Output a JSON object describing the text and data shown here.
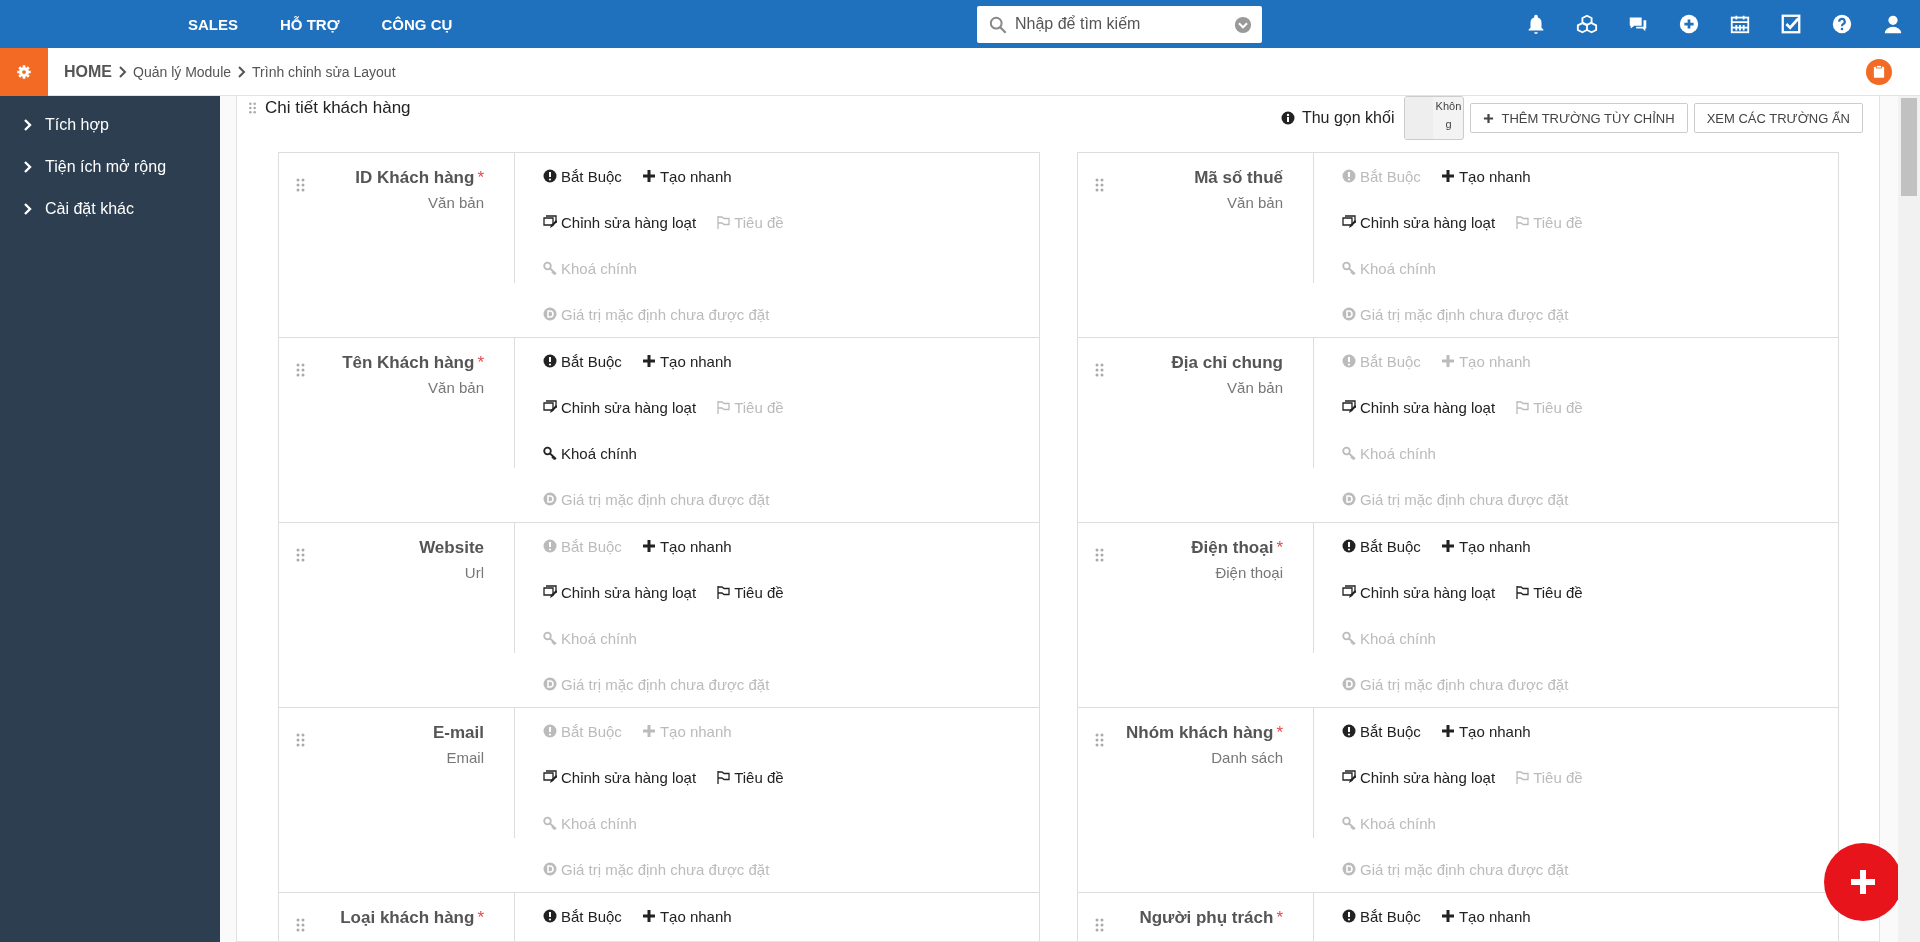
{
  "top_nav": {
    "items": [
      {
        "label": "SALES"
      },
      {
        "label": "HỖ TRỢ"
      },
      {
        "label": "CÔNG CỤ"
      }
    ],
    "search": {
      "placeholder": "Nhập để tìm kiếm"
    },
    "icons": [
      {
        "kind": "bell"
      },
      {
        "kind": "cubes"
      },
      {
        "kind": "comments"
      },
      {
        "kind": "plus"
      },
      {
        "kind": "calendar"
      },
      {
        "kind": "check"
      },
      {
        "kind": "help"
      },
      {
        "kind": "user"
      }
    ]
  },
  "breadcrumb": {
    "items": [
      {
        "label": "HOME",
        "kind": "home"
      },
      {
        "label": "Quản lý Module",
        "kind": "link"
      },
      {
        "label": "Trình chỉnh sửa Layout",
        "kind": "link"
      }
    ]
  },
  "sidebar": {
    "items": [
      {
        "label": "Tích hợp"
      },
      {
        "label": "Tiện ích mở rộng"
      },
      {
        "label": "Cài đặt khác"
      }
    ]
  },
  "block": {
    "title": "Chi tiết khách hàng",
    "collapse": {
      "label": "Thu gọn khối",
      "toggle_text": "Không",
      "on": false
    },
    "buttons": [
      {
        "label": "THÊM TRƯỜNG TÙY CHỈNH",
        "kind": "add"
      },
      {
        "label": "XEM CÁC TRƯỜNG ẨN",
        "kind": "plain"
      }
    ],
    "columns": [
      {
        "fields": [
          {
            "name": "ID Khách hàng",
            "required_mark": "*",
            "type": "Văn bản",
            "option_rows": [
              [
                {
                  "kind": "required",
                  "label": "Bắt Buộc",
                  "on": true
                },
                {
                  "kind": "quick_create",
                  "label": "Tạo nhanh",
                  "on": true
                }
              ],
              [
                {
                  "kind": "mass_edit",
                  "label": "Chỉnh sửa hàng loạt",
                  "on": true
                },
                {
                  "kind": "title",
                  "label": "Tiêu đề",
                  "on": false
                }
              ],
              [
                {
                  "kind": "primary_key",
                  "label": "Khoá chính",
                  "on": false
                }
              ],
              [
                {
                  "kind": "default",
                  "label": "Giá trị mặc định chưa được đặt",
                  "on": false
                }
              ]
            ]
          },
          {
            "name": "Tên Khách hàng",
            "required_mark": "*",
            "type": "Văn bản",
            "option_rows": [
              [
                {
                  "kind": "required",
                  "label": "Bắt Buộc",
                  "on": true
                },
                {
                  "kind": "quick_create",
                  "label": "Tạo nhanh",
                  "on": true
                }
              ],
              [
                {
                  "kind": "mass_edit",
                  "label": "Chỉnh sửa hàng loạt",
                  "on": true
                },
                {
                  "kind": "title",
                  "label": "Tiêu đề",
                  "on": false
                }
              ],
              [
                {
                  "kind": "primary_key",
                  "label": "Khoá chính",
                  "on": true
                }
              ],
              [
                {
                  "kind": "default",
                  "label": "Giá trị mặc định chưa được đặt",
                  "on": false
                }
              ]
            ]
          },
          {
            "name": "Website",
            "type": "Url",
            "option_rows": [
              [
                {
                  "kind": "required",
                  "label": "Bắt Buộc",
                  "on": false
                },
                {
                  "kind": "quick_create",
                  "label": "Tạo nhanh",
                  "on": true
                }
              ],
              [
                {
                  "kind": "mass_edit",
                  "label": "Chỉnh sửa hàng loạt",
                  "on": true
                },
                {
                  "kind": "title",
                  "label": "Tiêu đề",
                  "on": true
                }
              ],
              [
                {
                  "kind": "primary_key",
                  "label": "Khoá chính",
                  "on": false
                }
              ],
              [
                {
                  "kind": "default",
                  "label": "Giá trị mặc định chưa được đặt",
                  "on": false
                }
              ]
            ]
          },
          {
            "name": "E-mail",
            "type": "Email",
            "option_rows": [
              [
                {
                  "kind": "required",
                  "label": "Bắt Buộc",
                  "on": false
                },
                {
                  "kind": "quick_create",
                  "label": "Tạo nhanh",
                  "on": false
                }
              ],
              [
                {
                  "kind": "mass_edit",
                  "label": "Chỉnh sửa hàng loạt",
                  "on": true
                },
                {
                  "kind": "title",
                  "label": "Tiêu đề",
                  "on": true
                }
              ],
              [
                {
                  "kind": "primary_key",
                  "label": "Khoá chính",
                  "on": false
                }
              ],
              [
                {
                  "kind": "default",
                  "label": "Giá trị mặc định chưa được đặt",
                  "on": false
                }
              ]
            ]
          },
          {
            "name": "Loại khách hàng",
            "required_mark": "*",
            "option_rows": [
              [
                {
                  "kind": "required",
                  "label": "Bắt Buộc",
                  "on": true
                },
                {
                  "kind": "quick_create",
                  "label": "Tạo nhanh",
                  "on": true
                }
              ]
            ]
          }
        ]
      },
      {
        "fields": [
          {
            "name": "Mã số thuế",
            "type": "Văn bản",
            "option_rows": [
              [
                {
                  "kind": "required",
                  "label": "Bắt Buộc",
                  "on": false
                },
                {
                  "kind": "quick_create",
                  "label": "Tạo nhanh",
                  "on": true
                }
              ],
              [
                {
                  "kind": "mass_edit",
                  "label": "Chỉnh sửa hàng loạt",
                  "on": true
                },
                {
                  "kind": "title",
                  "label": "Tiêu đề",
                  "on": false
                }
              ],
              [
                {
                  "kind": "primary_key",
                  "label": "Khoá chính",
                  "on": false
                }
              ],
              [
                {
                  "kind": "default",
                  "label": "Giá trị mặc định chưa được đặt",
                  "on": false
                }
              ]
            ]
          },
          {
            "name": "Địa chỉ chung",
            "type": "Văn bản",
            "option_rows": [
              [
                {
                  "kind": "required",
                  "label": "Bắt Buộc",
                  "on": false
                },
                {
                  "kind": "quick_create",
                  "label": "Tạo nhanh",
                  "on": false
                }
              ],
              [
                {
                  "kind": "mass_edit",
                  "label": "Chỉnh sửa hàng loạt",
                  "on": true
                },
                {
                  "kind": "title",
                  "label": "Tiêu đề",
                  "on": false
                }
              ],
              [
                {
                  "kind": "primary_key",
                  "label": "Khoá chính",
                  "on": false
                }
              ],
              [
                {
                  "kind": "default",
                  "label": "Giá trị mặc định chưa được đặt",
                  "on": false
                }
              ]
            ]
          },
          {
            "name": "Điện thoại",
            "required_mark": "*",
            "type": "Điện thoại",
            "option_rows": [
              [
                {
                  "kind": "required",
                  "label": "Bắt Buộc",
                  "on": true
                },
                {
                  "kind": "quick_create",
                  "label": "Tạo nhanh",
                  "on": true
                }
              ],
              [
                {
                  "kind": "mass_edit",
                  "label": "Chỉnh sửa hàng loạt",
                  "on": true
                },
                {
                  "kind": "title",
                  "label": "Tiêu đề",
                  "on": true
                }
              ],
              [
                {
                  "kind": "primary_key",
                  "label": "Khoá chính",
                  "on": false
                }
              ],
              [
                {
                  "kind": "default",
                  "label": "Giá trị mặc định chưa được đặt",
                  "on": false
                }
              ]
            ]
          },
          {
            "name": "Nhóm khách hàng",
            "required_mark": "*",
            "type": "Danh sách",
            "option_rows": [
              [
                {
                  "kind": "required",
                  "label": "Bắt Buộc",
                  "on": true
                },
                {
                  "kind": "quick_create",
                  "label": "Tạo nhanh",
                  "on": true
                }
              ],
              [
                {
                  "kind": "mass_edit",
                  "label": "Chỉnh sửa hàng loạt",
                  "on": true
                },
                {
                  "kind": "title",
                  "label": "Tiêu đề",
                  "on": false
                }
              ],
              [
                {
                  "kind": "primary_key",
                  "label": "Khoá chính",
                  "on": false
                }
              ],
              [
                {
                  "kind": "default",
                  "label": "Giá trị mặc định chưa được đặt",
                  "on": false
                }
              ]
            ]
          },
          {
            "name": "Người phụ trách",
            "required_mark": "*",
            "option_rows": [
              [
                {
                  "kind": "required",
                  "label": "Bắt Buộc",
                  "on": true
                },
                {
                  "kind": "quick_create",
                  "label": "Tạo nhanh",
                  "on": true
                }
              ]
            ]
          }
        ]
      }
    ]
  }
}
